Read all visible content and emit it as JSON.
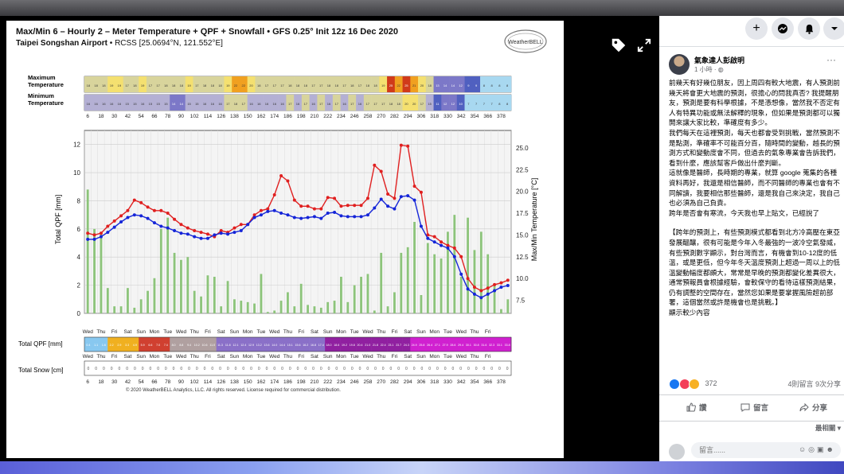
{
  "chart": {
    "title_line": "Max/Min 6 – Hourly 2 – Meter Temperature + QPF + Snowfall • GFS 0.25° Init 12z 16 Dec 2020",
    "station_name": "Taipei Songshan Airport",
    "station_rest": " • RCSS [25.0694°N, 121.552°E]",
    "logo_text": "WeatherBELL",
    "copyright": "© 2020 WeatherBELL Analytics, LLC. All rights reserved. License required for commercial distribution.",
    "row_max_label_1": "Maximum",
    "row_max_label_2": "Temperature",
    "row_min_label_1": "Minimum",
    "row_min_label_2": "Temperature",
    "row_qpf_label": "Total QPF [mm]",
    "row_snow_label": "Total Snow [cm]",
    "max_temps": [
      18,
      18,
      18,
      19,
      19,
      17,
      18,
      19,
      17,
      17,
      18,
      18,
      18,
      19,
      17,
      18,
      18,
      18,
      19,
      22,
      22,
      20,
      18,
      17,
      17,
      17,
      18,
      18,
      18,
      17,
      17,
      18,
      18,
      17,
      18,
      17,
      18,
      18,
      19,
      25,
      22,
      25,
      21,
      20,
      18,
      13,
      14,
      14,
      12,
      9,
      9,
      8,
      8,
      8,
      8
    ],
    "min_temps": [
      16,
      16,
      16,
      16,
      16,
      15,
      15,
      16,
      15,
      15,
      15,
      14,
      14,
      15,
      15,
      16,
      16,
      16,
      17,
      18,
      17,
      16,
      16,
      16,
      16,
      16,
      17,
      16,
      17,
      16,
      17,
      16,
      17,
      16,
      17,
      16,
      17,
      17,
      17,
      18,
      18,
      20,
      20,
      17,
      15,
      11,
      12,
      12,
      10,
      7,
      7,
      7,
      7,
      8,
      8
    ],
    "qpf_cells": [
      "0.4",
      "1.1",
      "1.6",
      "2.2",
      "2.9",
      "3.3",
      "4.9",
      "5.9",
      "6.6",
      "7.0",
      "7.4",
      "8.0",
      "8.8",
      "9.4",
      "10.2",
      "10.6",
      "11.0",
      "11.3",
      "11.8",
      "12.1",
      "12.4",
      "12.9",
      "13.2",
      "13.6",
      "14.0",
      "14.4",
      "15.1",
      "15.6",
      "16.2",
      "16.8",
      "17.4",
      "18.0",
      "18.6",
      "19.2",
      "19.8",
      "20.4",
      "21.0",
      "21.8",
      "22.4",
      "23.1",
      "23.7",
      "24.3",
      "24.9",
      "25.8",
      "26.4",
      "27.1",
      "27.9",
      "28.6",
      "29.4",
      "30.1",
      "30.8",
      "31.6",
      "32.3",
      "33.1",
      "33.8"
    ],
    "snow_cells": [
      "0",
      "0",
      "0",
      "0",
      "0",
      "0",
      "0",
      "0",
      "0",
      "0",
      "0",
      "0",
      "0",
      "0",
      "0",
      "0",
      "0",
      "0",
      "0",
      "0",
      "0",
      "0",
      "0",
      "0",
      "0",
      "0",
      "0",
      "0",
      "0",
      "0",
      "0",
      "0",
      "0",
      "0",
      "0",
      "0",
      "0",
      "0",
      "0",
      "0",
      "0",
      "0",
      "0",
      "0",
      "0",
      "0",
      "0",
      "0",
      "0",
      "0",
      "0",
      "0",
      "0",
      "0",
      "0"
    ],
    "hour_ticks": [
      "6",
      "18",
      "30",
      "42",
      "54",
      "66",
      "78",
      "90",
      "102",
      "114",
      "126",
      "138",
      "150",
      "162",
      "174",
      "186",
      "198",
      "210",
      "222",
      "234",
      "246",
      "258",
      "270",
      "282",
      "294",
      "306",
      "318",
      "330",
      "342",
      "354",
      "366",
      "378"
    ],
    "weekday_labels": [
      "Wed",
      "Thu",
      "Fri",
      "Sat",
      "Sun",
      "Mon",
      "Tue",
      "Wed",
      "Thu",
      "Fri",
      "Sat",
      "Sun",
      "Mon",
      "Tue",
      "Wed",
      "Thu",
      "Fri",
      "Sat",
      "Sun",
      "Mon",
      "Tue",
      "Wed",
      "Thu",
      "Fri",
      "Sat",
      "Sun",
      "Mon",
      "Tue",
      "Wed",
      "Thu",
      "Fri"
    ],
    "ylabel_left": "Total QPF  [mm]",
    "ylabel_right": "Max/Min Temperature  [°C]"
  },
  "chart_data": {
    "type": "line",
    "title": "Max/Min 6 – Hourly 2 – Meter Temperature + QPF + Snowfall • GFS 0.25°",
    "xlabel": "",
    "ylabel": "Total QPF [mm]",
    "ylabel_right": "Max/Min Temperature [°C]",
    "ylim_left": [
      0,
      13
    ],
    "ylim_right": [
      6,
      27
    ],
    "left_ticks": [
      0,
      2,
      4,
      6,
      8,
      10,
      12
    ],
    "right_ticks": [
      7.5,
      10.0,
      12.5,
      15.0,
      17.5,
      20.0,
      22.5,
      25.0
    ],
    "grid": true,
    "x": [
      6,
      12,
      18,
      24,
      30,
      36,
      42,
      48,
      54,
      60,
      66,
      72,
      78,
      84,
      90,
      96,
      102,
      108,
      114,
      120,
      126,
      132,
      138,
      144,
      150,
      156,
      162,
      168,
      174,
      180,
      186,
      192,
      198,
      204,
      210,
      216,
      222,
      228,
      234,
      240,
      246,
      252,
      258,
      264,
      270,
      276,
      282,
      288,
      294,
      300,
      306,
      312,
      318,
      324,
      330,
      336,
      342,
      348,
      354,
      360,
      366,
      372,
      378,
      384
    ],
    "qpf_bars": [
      8.8,
      6.0,
      5.8,
      1.8,
      0.5,
      0.5,
      1.8,
      0.4,
      1.0,
      1.6,
      2.5,
      6.0,
      6.8,
      4.3,
      3.8,
      4.0,
      1.6,
      1.2,
      2.7,
      2.6,
      0.5,
      2.3,
      1.0,
      0.9,
      0.8,
      0.7,
      2.8,
      0.1,
      0.2,
      0.9,
      1.5,
      0.5,
      2.1,
      0.6,
      0.5,
      0.4,
      0.8,
      0.9,
      2.6,
      0.8,
      2.0,
      2.6,
      2.8,
      0.2,
      4.3,
      0.5,
      1.5,
      4.3,
      4.7,
      6.5,
      1.3,
      5.0,
      4.2,
      3.9,
      5.8,
      7.0,
      2.6,
      6.8,
      4.5,
      5.8,
      4.2,
      2.1,
      0.3,
      1.0
    ],
    "series": [
      {
        "name": "",
        "color": "#e02020",
        "values": [
          15.2,
          15.0,
          15.2,
          16.0,
          16.6,
          17.2,
          17.8,
          19.0,
          18.7,
          18.2,
          17.8,
          17.8,
          17.5,
          16.8,
          16.2,
          15.8,
          15.5,
          15.3,
          15.1,
          14.8,
          15.5,
          15.3,
          15.8,
          16.2,
          16.2,
          17.3,
          17.8,
          18.0,
          19.6,
          21.8,
          21.2,
          19.0,
          18.3,
          18.3,
          18.0,
          18.0,
          19.3,
          19.2,
          18.3,
          18.4,
          18.4,
          18.4,
          19.2,
          23.0,
          22.3,
          19.7,
          19.2,
          25.3,
          25.2,
          20.6,
          19.9,
          15.0,
          14.8,
          14.2,
          13.8,
          13.5,
          12.5,
          10.0,
          9.0,
          8.6,
          8.9,
          9.3,
          9.5,
          9.8
        ]
      },
      {
        "name": "",
        "color": "#1525d8",
        "values": [
          14.5,
          14.5,
          14.8,
          15.3,
          15.9,
          16.5,
          17.0,
          17.3,
          17.2,
          16.9,
          16.4,
          16.0,
          15.8,
          15.5,
          15.2,
          15.1,
          14.8,
          14.6,
          14.6,
          15.0,
          15.2,
          15.1,
          15.3,
          15.5,
          16.2,
          17.0,
          17.3,
          17.7,
          17.8,
          17.5,
          17.3,
          17.0,
          16.9,
          17.0,
          17.1,
          16.9,
          17.5,
          17.6,
          17.2,
          17.1,
          17.1,
          17.1,
          17.3,
          18.1,
          19.1,
          18.3,
          18.0,
          19.4,
          19.5,
          19.0,
          16.0,
          14.6,
          14.2,
          13.8,
          13.5,
          12.5,
          10.5,
          8.8,
          8.2,
          7.8,
          8.2,
          8.6,
          9.0,
          9.2
        ]
      }
    ]
  },
  "sidebar": {
    "author": "氣象達人彭啟明",
    "time": "1 小時 · ",
    "post_paragraphs": [
      "前幾天有好幾位朋友，因上周四有較大地震，有人預測前幾天將會更大地震的預測，很擔心的問我真否? 我提醒朋友，預測是要有科學根據，不是憑想像，當然我不否定有人有特異功能或無法解釋的現象，但如果是預測都可以獨開來讓大家比較，準確度有多少。",
      "我們每天在這裡預測，每天也都會受到挑戰，當然預測不是點測，準確率不可能百分百，隨時間的變動，越長的預測方式和變動度會不同，但過去的氣象專業會告訴我們，看到什麼，應該幫客戶做出什麼判斷。",
      "這就像是醫師，長時期的專業，就算 google 蒐集的各種資料再好，我還是相信醫師，而不同醫師的專業也會有不同解讀，我要相信那些醫師，還是我自己來決定，我自己也必須為自己負責。",
      "跨年是否會有寒流，今天我也早上貼文，已經說了",
      "【跨年的預測上，有些預測模式都看到北方冷高壓在東亞發展醞釀，很有可能是今年入冬最強的一波冷空氣發威，有些預測數字顯示，對台灣而言，有機會到10-12度的低溫，或是更低，但今年冬天溫度預測上超過一周以上的低溫變動幅度都頗大，常常是早晚的預測都變化差異很大，通常預報員會根據經驗，會較保守的看待這樣預測結果，仍有調整的空間存在，當然您如果是要掌握風險超前部署，這個當然或許是機會也是挑戰。】"
    ],
    "show_less": "顯示較少內容",
    "reaction_count": "372",
    "comments_shares": "4則留言  9次分享",
    "like_label": "讚",
    "comment_label": "留言",
    "share_label": "分享",
    "sort_label": "最相關",
    "comment_placeholder": "留言......"
  },
  "colors": {
    "max_line": "#e02020",
    "min_line": "#1525d8",
    "bars": "#8cc47a",
    "fb_blue": "#1877f2"
  }
}
